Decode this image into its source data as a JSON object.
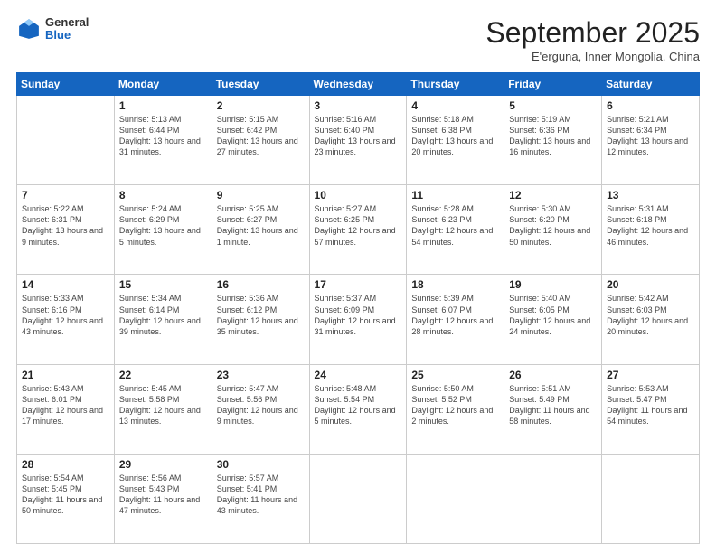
{
  "header": {
    "logo_general": "General",
    "logo_blue": "Blue",
    "month_title": "September 2025",
    "location": "E'erguna, Inner Mongolia, China"
  },
  "weekdays": [
    "Sunday",
    "Monday",
    "Tuesday",
    "Wednesday",
    "Thursday",
    "Friday",
    "Saturday"
  ],
  "weeks": [
    [
      {
        "day": "",
        "sunrise": "",
        "sunset": "",
        "daylight": ""
      },
      {
        "day": "1",
        "sunrise": "Sunrise: 5:13 AM",
        "sunset": "Sunset: 6:44 PM",
        "daylight": "Daylight: 13 hours and 31 minutes."
      },
      {
        "day": "2",
        "sunrise": "Sunrise: 5:15 AM",
        "sunset": "Sunset: 6:42 PM",
        "daylight": "Daylight: 13 hours and 27 minutes."
      },
      {
        "day": "3",
        "sunrise": "Sunrise: 5:16 AM",
        "sunset": "Sunset: 6:40 PM",
        "daylight": "Daylight: 13 hours and 23 minutes."
      },
      {
        "day": "4",
        "sunrise": "Sunrise: 5:18 AM",
        "sunset": "Sunset: 6:38 PM",
        "daylight": "Daylight: 13 hours and 20 minutes."
      },
      {
        "day": "5",
        "sunrise": "Sunrise: 5:19 AM",
        "sunset": "Sunset: 6:36 PM",
        "daylight": "Daylight: 13 hours and 16 minutes."
      },
      {
        "day": "6",
        "sunrise": "Sunrise: 5:21 AM",
        "sunset": "Sunset: 6:34 PM",
        "daylight": "Daylight: 13 hours and 12 minutes."
      }
    ],
    [
      {
        "day": "7",
        "sunrise": "Sunrise: 5:22 AM",
        "sunset": "Sunset: 6:31 PM",
        "daylight": "Daylight: 13 hours and 9 minutes."
      },
      {
        "day": "8",
        "sunrise": "Sunrise: 5:24 AM",
        "sunset": "Sunset: 6:29 PM",
        "daylight": "Daylight: 13 hours and 5 minutes."
      },
      {
        "day": "9",
        "sunrise": "Sunrise: 5:25 AM",
        "sunset": "Sunset: 6:27 PM",
        "daylight": "Daylight: 13 hours and 1 minute."
      },
      {
        "day": "10",
        "sunrise": "Sunrise: 5:27 AM",
        "sunset": "Sunset: 6:25 PM",
        "daylight": "Daylight: 12 hours and 57 minutes."
      },
      {
        "day": "11",
        "sunrise": "Sunrise: 5:28 AM",
        "sunset": "Sunset: 6:23 PM",
        "daylight": "Daylight: 12 hours and 54 minutes."
      },
      {
        "day": "12",
        "sunrise": "Sunrise: 5:30 AM",
        "sunset": "Sunset: 6:20 PM",
        "daylight": "Daylight: 12 hours and 50 minutes."
      },
      {
        "day": "13",
        "sunrise": "Sunrise: 5:31 AM",
        "sunset": "Sunset: 6:18 PM",
        "daylight": "Daylight: 12 hours and 46 minutes."
      }
    ],
    [
      {
        "day": "14",
        "sunrise": "Sunrise: 5:33 AM",
        "sunset": "Sunset: 6:16 PM",
        "daylight": "Daylight: 12 hours and 43 minutes."
      },
      {
        "day": "15",
        "sunrise": "Sunrise: 5:34 AM",
        "sunset": "Sunset: 6:14 PM",
        "daylight": "Daylight: 12 hours and 39 minutes."
      },
      {
        "day": "16",
        "sunrise": "Sunrise: 5:36 AM",
        "sunset": "Sunset: 6:12 PM",
        "daylight": "Daylight: 12 hours and 35 minutes."
      },
      {
        "day": "17",
        "sunrise": "Sunrise: 5:37 AM",
        "sunset": "Sunset: 6:09 PM",
        "daylight": "Daylight: 12 hours and 31 minutes."
      },
      {
        "day": "18",
        "sunrise": "Sunrise: 5:39 AM",
        "sunset": "Sunset: 6:07 PM",
        "daylight": "Daylight: 12 hours and 28 minutes."
      },
      {
        "day": "19",
        "sunrise": "Sunrise: 5:40 AM",
        "sunset": "Sunset: 6:05 PM",
        "daylight": "Daylight: 12 hours and 24 minutes."
      },
      {
        "day": "20",
        "sunrise": "Sunrise: 5:42 AM",
        "sunset": "Sunset: 6:03 PM",
        "daylight": "Daylight: 12 hours and 20 minutes."
      }
    ],
    [
      {
        "day": "21",
        "sunrise": "Sunrise: 5:43 AM",
        "sunset": "Sunset: 6:01 PM",
        "daylight": "Daylight: 12 hours and 17 minutes."
      },
      {
        "day": "22",
        "sunrise": "Sunrise: 5:45 AM",
        "sunset": "Sunset: 5:58 PM",
        "daylight": "Daylight: 12 hours and 13 minutes."
      },
      {
        "day": "23",
        "sunrise": "Sunrise: 5:47 AM",
        "sunset": "Sunset: 5:56 PM",
        "daylight": "Daylight: 12 hours and 9 minutes."
      },
      {
        "day": "24",
        "sunrise": "Sunrise: 5:48 AM",
        "sunset": "Sunset: 5:54 PM",
        "daylight": "Daylight: 12 hours and 5 minutes."
      },
      {
        "day": "25",
        "sunrise": "Sunrise: 5:50 AM",
        "sunset": "Sunset: 5:52 PM",
        "daylight": "Daylight: 12 hours and 2 minutes."
      },
      {
        "day": "26",
        "sunrise": "Sunrise: 5:51 AM",
        "sunset": "Sunset: 5:49 PM",
        "daylight": "Daylight: 11 hours and 58 minutes."
      },
      {
        "day": "27",
        "sunrise": "Sunrise: 5:53 AM",
        "sunset": "Sunset: 5:47 PM",
        "daylight": "Daylight: 11 hours and 54 minutes."
      }
    ],
    [
      {
        "day": "28",
        "sunrise": "Sunrise: 5:54 AM",
        "sunset": "Sunset: 5:45 PM",
        "daylight": "Daylight: 11 hours and 50 minutes."
      },
      {
        "day": "29",
        "sunrise": "Sunrise: 5:56 AM",
        "sunset": "Sunset: 5:43 PM",
        "daylight": "Daylight: 11 hours and 47 minutes."
      },
      {
        "day": "30",
        "sunrise": "Sunrise: 5:57 AM",
        "sunset": "Sunset: 5:41 PM",
        "daylight": "Daylight: 11 hours and 43 minutes."
      },
      {
        "day": "",
        "sunrise": "",
        "sunset": "",
        "daylight": ""
      },
      {
        "day": "",
        "sunrise": "",
        "sunset": "",
        "daylight": ""
      },
      {
        "day": "",
        "sunrise": "",
        "sunset": "",
        "daylight": ""
      },
      {
        "day": "",
        "sunrise": "",
        "sunset": "",
        "daylight": ""
      }
    ]
  ]
}
